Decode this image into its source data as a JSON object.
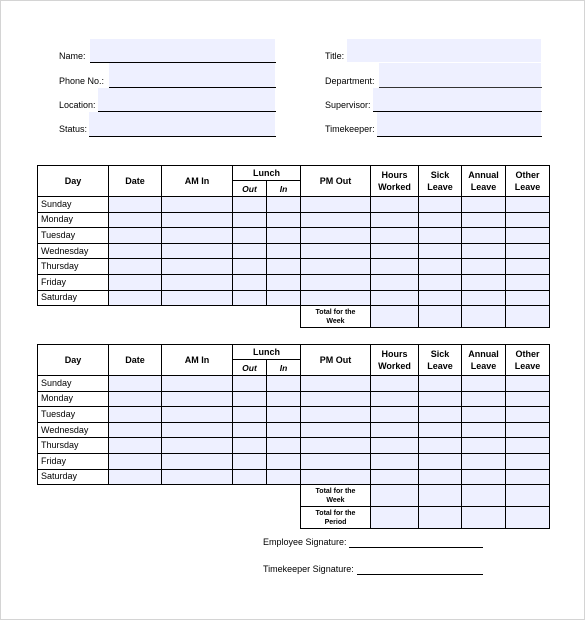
{
  "header_fields": {
    "left": [
      {
        "label": "Name:",
        "value": ""
      },
      {
        "label": "Phone No.:",
        "value": ""
      },
      {
        "label": "Location:",
        "value": ""
      },
      {
        "label": "Status:",
        "value": ""
      }
    ],
    "right": [
      {
        "label": "Title:",
        "value": ""
      },
      {
        "label": "Department:",
        "value": ""
      },
      {
        "label": "Supervisor:",
        "value": ""
      },
      {
        "label": "Timekeeper:",
        "value": ""
      }
    ]
  },
  "table_headers": {
    "day": "Day",
    "date": "Date",
    "am_in": "AM In",
    "lunch": "Lunch",
    "lunch_out": "Out",
    "lunch_in": "In",
    "pm_out": "PM Out",
    "hours_worked_1": "Hours",
    "hours_worked_2": "Worked",
    "sick_leave_1": "Sick",
    "sick_leave_2": "Leave",
    "annual_leave_1": "Annual",
    "annual_leave_2": "Leave",
    "other_leave_1": "Other",
    "other_leave_2": "Leave"
  },
  "days": [
    "Sunday",
    "Monday",
    "Tuesday",
    "Wednesday",
    "Thursday",
    "Friday",
    "Saturday"
  ],
  "week1": {
    "total_week_1": "Total for the",
    "total_week_2": "Week"
  },
  "week2": {
    "total_week_1": "Total for the",
    "total_week_2": "Week",
    "total_period_1": "Total for the",
    "total_period_2": "Period"
  },
  "signatures": {
    "employee": "Employee Signature:",
    "timekeeper": "Timekeeper Signature:"
  },
  "colors": {
    "field_fill": "#eef0ff",
    "border": "#000000"
  }
}
